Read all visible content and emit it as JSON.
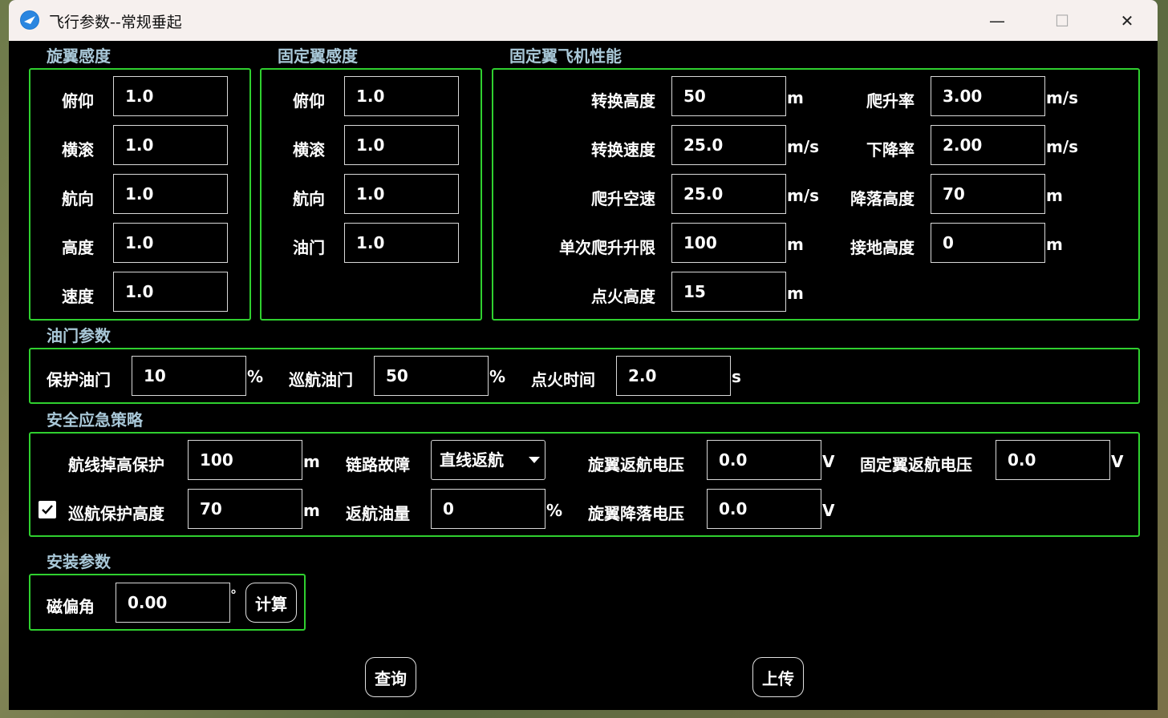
{
  "window": {
    "title": "飞行参数--常规垂起",
    "minimize": "—",
    "maximize": "☐",
    "close": "✕"
  },
  "rotor_sensitivity": {
    "label": "旋翼感度",
    "fields": [
      {
        "label": "俯仰",
        "value": "1.0"
      },
      {
        "label": "横滚",
        "value": "1.0"
      },
      {
        "label": "航向",
        "value": "1.0"
      },
      {
        "label": "高度",
        "value": "1.0"
      },
      {
        "label": "速度",
        "value": "1.0"
      }
    ]
  },
  "fixed_wing_sensitivity": {
    "label": "固定翼感度",
    "fields": [
      {
        "label": "俯仰",
        "value": "1.0"
      },
      {
        "label": "横滚",
        "value": "1.0"
      },
      {
        "label": "航向",
        "value": "1.0"
      },
      {
        "label": "油门",
        "value": "1.0"
      }
    ]
  },
  "fixed_wing_performance": {
    "label": "固定翼飞机性能",
    "left": [
      {
        "label": "转换高度",
        "value": "50",
        "unit": "m"
      },
      {
        "label": "转换速度",
        "value": "25.0",
        "unit": "m/s"
      },
      {
        "label": "爬升空速",
        "value": "25.0",
        "unit": "m/s"
      },
      {
        "label": "单次爬升升限",
        "value": "100",
        "unit": "m"
      },
      {
        "label": "点火高度",
        "value": "15",
        "unit": "m"
      }
    ],
    "right": [
      {
        "label": "爬升率",
        "value": "3.00",
        "unit": "m/s"
      },
      {
        "label": "下降率",
        "value": "2.00",
        "unit": "m/s"
      },
      {
        "label": "降落高度",
        "value": "70",
        "unit": "m"
      },
      {
        "label": "接地高度",
        "value": "0",
        "unit": "m"
      }
    ]
  },
  "throttle": {
    "label": "油门参数",
    "protect_label": "保护油门",
    "protect_value": "10",
    "protect_unit": "%",
    "cruise_label": "巡航油门",
    "cruise_value": "50",
    "cruise_unit": "%",
    "ignition_label": "点火时间",
    "ignition_value": "2.0",
    "ignition_unit": "s"
  },
  "safety": {
    "label": "安全应急策略",
    "route_drop_label": "航线掉高保护",
    "route_drop_value": "100",
    "route_drop_unit": "m",
    "link_fault_label": "链路故障",
    "link_fault_value": "直线返航",
    "rotor_rth_voltage_label": "旋翼返航电压",
    "rotor_rth_voltage_value": "0.0",
    "rotor_rth_voltage_unit": "V",
    "fixed_rth_voltage_label": "固定翼返航电压",
    "fixed_rth_voltage_value": "0.0",
    "fixed_rth_voltage_unit": "V",
    "cruise_protect_label": "巡航保护高度",
    "cruise_protect_checked": true,
    "cruise_protect_value": "70",
    "cruise_protect_unit": "m",
    "rth_fuel_label": "返航油量",
    "rth_fuel_value": "0",
    "rth_fuel_unit": "%",
    "rotor_land_voltage_label": "旋翼降落电压",
    "rotor_land_voltage_value": "0.0",
    "rotor_land_voltage_unit": "V"
  },
  "install": {
    "label": "安装参数",
    "mag_label": "磁偏角",
    "mag_value": "0.00",
    "mag_unit": "°",
    "calc_button": "计算"
  },
  "actions": {
    "query": "查询",
    "upload": "上传"
  }
}
